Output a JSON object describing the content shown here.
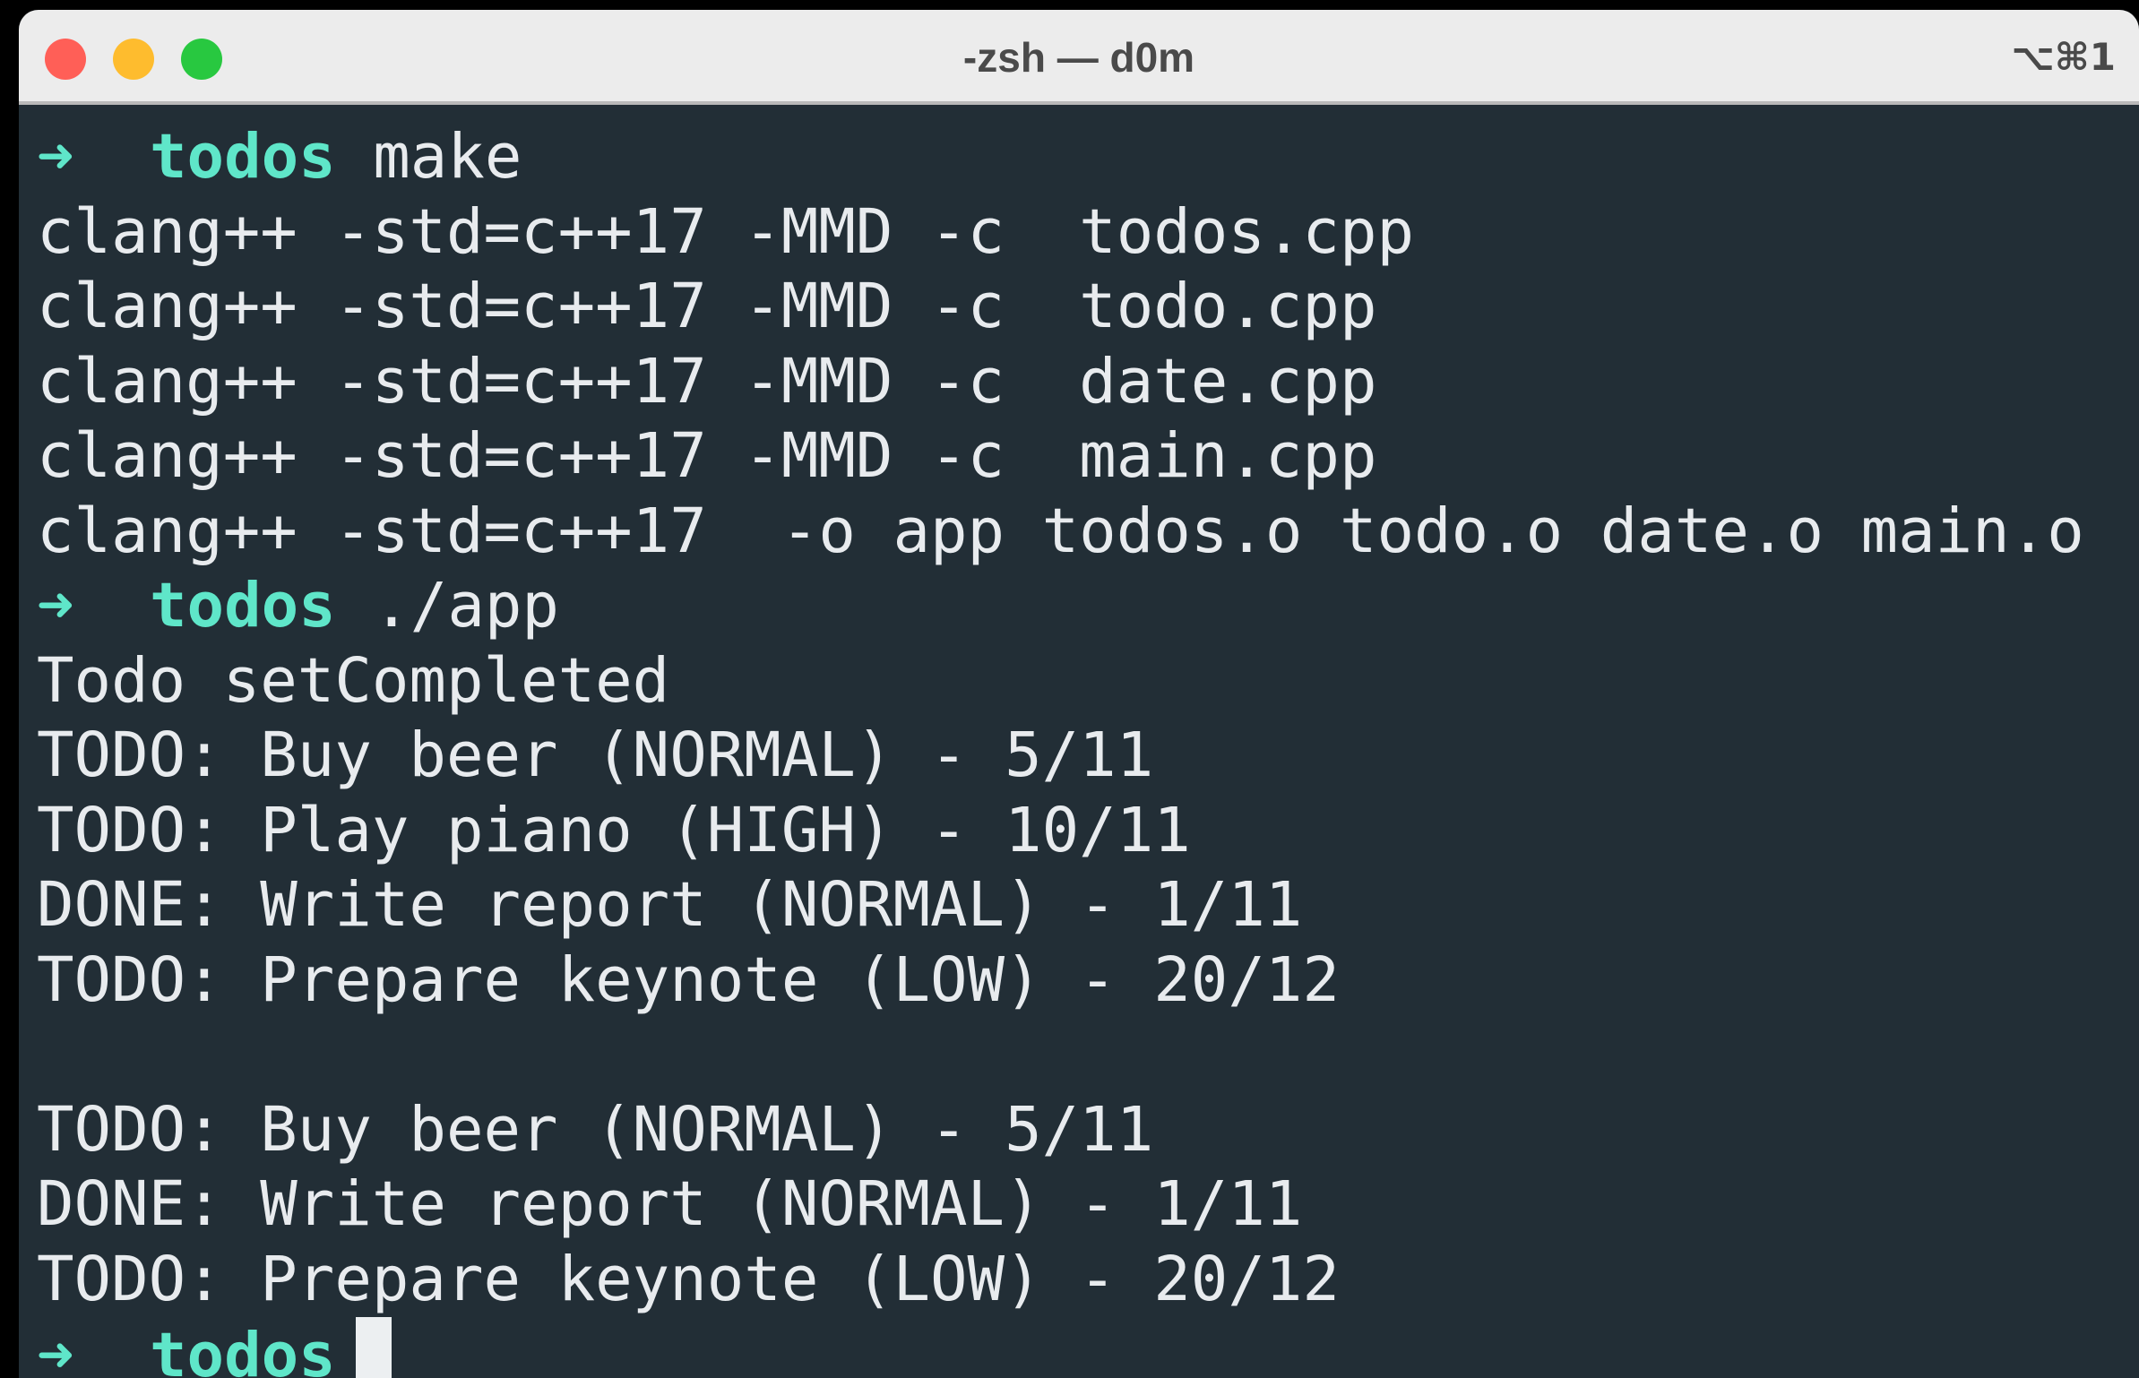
{
  "window": {
    "title": "-zsh — d0m",
    "shortcut": "⌥⌘1",
    "buttons": {
      "close_color": "#ff5f57",
      "minimize_color": "#febc2e",
      "zoom_color": "#28c840"
    }
  },
  "theme": {
    "background": "#222e36",
    "foreground": "#e8ebee",
    "prompt_color": "#5fe6c9"
  },
  "terminal": {
    "prompt_symbol": "➜",
    "lines": [
      {
        "type": "prompt",
        "dir": "todos",
        "cmd": "make"
      },
      {
        "type": "output",
        "text": "clang++ -std=c++17 -MMD -c  todos.cpp"
      },
      {
        "type": "output",
        "text": "clang++ -std=c++17 -MMD -c  todo.cpp"
      },
      {
        "type": "output",
        "text": "clang++ -std=c++17 -MMD -c  date.cpp"
      },
      {
        "type": "output",
        "text": "clang++ -std=c++17 -MMD -c  main.cpp"
      },
      {
        "type": "output",
        "text": "clang++ -std=c++17  -o app todos.o todo.o date.o main.o"
      },
      {
        "type": "prompt",
        "dir": "todos",
        "cmd": "./app"
      },
      {
        "type": "output",
        "text": "Todo setCompleted"
      },
      {
        "type": "output",
        "text": "TODO: Buy beer (NORMAL) - 5/11"
      },
      {
        "type": "output",
        "text": "TODO: Play piano (HIGH) - 10/11"
      },
      {
        "type": "output",
        "text": "DONE: Write report (NORMAL) - 1/11"
      },
      {
        "type": "output",
        "text": "TODO: Prepare keynote (LOW) - 20/12"
      },
      {
        "type": "output",
        "text": ""
      },
      {
        "type": "output",
        "text": "TODO: Buy beer (NORMAL) - 5/11"
      },
      {
        "type": "output",
        "text": "DONE: Write report (NORMAL) - 1/11"
      },
      {
        "type": "output",
        "text": "TODO: Prepare keynote (LOW) - 20/12"
      },
      {
        "type": "active-prompt",
        "dir": "todos",
        "cmd": ""
      }
    ]
  }
}
